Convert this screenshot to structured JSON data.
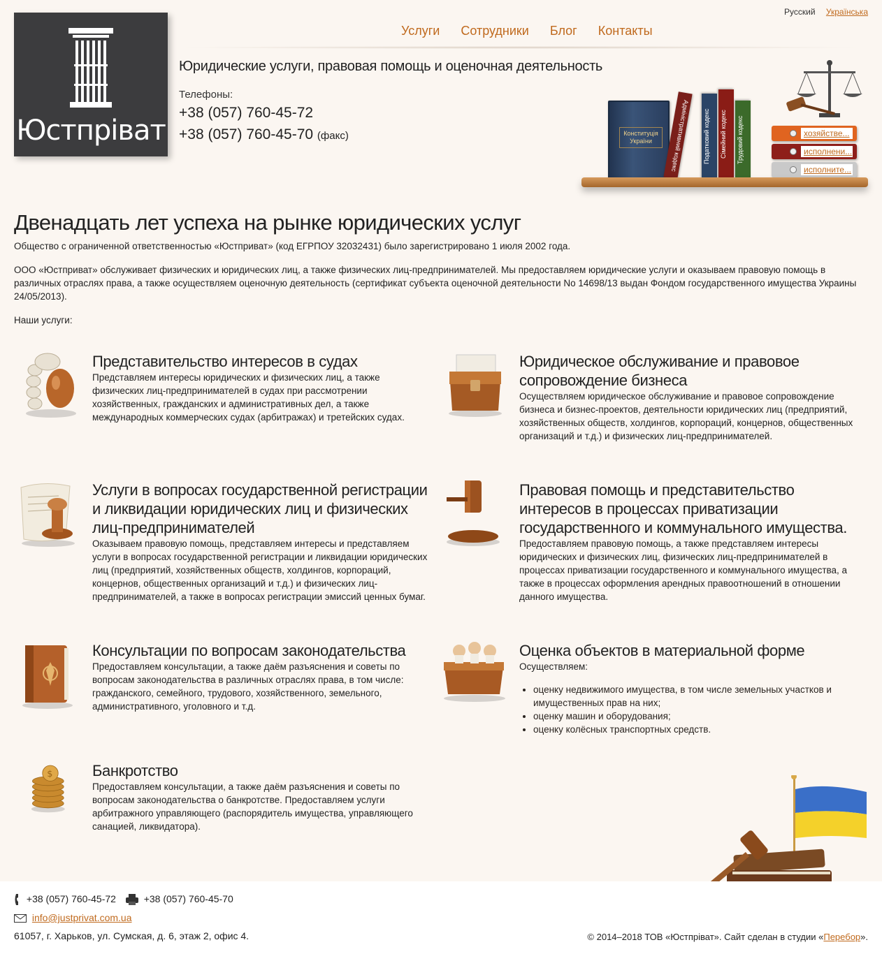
{
  "brand": {
    "name": "Юстпріват"
  },
  "lang": {
    "current": "Русский",
    "other": "Українська"
  },
  "nav": [
    "Услуги",
    "Сотрудники",
    "Блог",
    "Контакты"
  ],
  "header": {
    "tagline": "Юридические услуги, правовая помощь и оценочная деятельность",
    "phones_label": "Телефоны:",
    "phone1": "+38 (057) 760-45-72",
    "phone2": "+38 (057) 760-45-70",
    "fax_label": "(факс)"
  },
  "shelf": {
    "constitution": "Конституція України",
    "spines": [
      "Адміністративний кодекс",
      "Податковий кодекс",
      "Сімейний кодекс",
      "Трудовий кодекс"
    ],
    "folders": [
      "хозяйстве...",
      "исполнени...",
      "исполните..."
    ]
  },
  "main": {
    "title": "Двенадцать лет успеха на рынке юридических услуг",
    "p1": "Общество с ограниченной ответственностью «Юстприват» (код ЕГРПОУ 32032431) было зарегистрировано 1 июля 2002 года.",
    "p2": "ООО «Юстприват» обслуживает физических и юридических лиц, а также физических лиц-предпринимателей. Мы предоставляем юридические услуги и оказываем правовую помощь в различных отраслях права, а также осуществляем оценочную деятельность (сертификат субъекта оценочной деятельности No 14698/13 выдан Фондом государственного имущества Украины 24/05/2013).",
    "p3": "Наши услуги:"
  },
  "services": [
    {
      "title": "Представительство интересов в судах",
      "text": "Представляем интересы юридических и физических лиц, а также физических лиц-предпринимателей в судах при рассмотрении хозяйственных, гражданских и административных дел, а также международных коммерческих судах (арбитражах) и третейских судах."
    },
    {
      "title": "Юридическое обслуживание и правовое сопровождение бизнеса",
      "text": "Осуществляем юридическое обслуживание и правовое сопровождение бизнеса и бизнес-проектов, деятельности юридических лиц (предприятий, хозяйственных обществ, холдингов, корпораций, концернов, общественных организаций и т.д.) и физических лиц-предпринимателей."
    },
    {
      "title": "Услуги в вопросах государственной регистрации и ликвидации юридических лиц и физических лиц-предпринимателей",
      "text": "Оказываем правовую помощь, представляем интересы и представляем услуги в вопросах государственной регистрации и ликвидации юридических лиц (предприятий, хозяйственных обществ, холдингов, корпораций, концернов, общественных организаций и т.д.) и физических лиц-предпринимателей, а также в вопросах регистрации эмиссий ценных бумаг."
    },
    {
      "title": "Правовая помощь и представительство интересов в процессах приватизации государственного и коммунального имущества.",
      "text": "Предоставляем правовую помощь, а также представляем интересы юридических и физических лиц, физических лиц-предпринимателей в процессах приватизации государственного и коммунального имущества, а также в процессах оформления арендных правоотношений в отношении данного имущества."
    },
    {
      "title": "Консультации по вопросам законодательства",
      "text": "Предоставляем консультации, а также даём разъяснения и советы по вопросам законодательства в различных отраслях права, в том числе: гражданского, семейного, трудового, хозяйственного, земельного, административного, уголовного и т.д."
    },
    {
      "title": "Оценка объектов в материальной форме",
      "text": "Осуществляем:",
      "items": [
        "оценку недвижимого имущества, в том числе земельных участков и имущественных прав на них;",
        "оценку машин и оборудования;",
        "оценку колёсных транспортных средств."
      ]
    },
    {
      "title": "Банкротство",
      "text": "Предоставляем консультации, а также даём разъяснения и советы по вопросам законодательства о банкротстве. Предоставляем услуги арбитражного управляющего (распорядитель имущества, управляющего санацией, ликвидатора)."
    }
  ],
  "footer": {
    "phone": "+38 (057) 760-45-72",
    "fax": "+38 (057) 760-45-70",
    "email": "info@justprivat.com.ua",
    "address": "61057, г. Харьков, ул. Сумская, д. 6, этаж 2, офис 4.",
    "copyright_pre": "© 2014–2018 ТОВ «Юстпріват». Сайт сделан в студии «",
    "studio": "Перебор",
    "copyright_post": "»."
  },
  "colors": {
    "accent": "#c06a1e",
    "background": "#fbf6f1",
    "logo_bg": "#3c3c3e"
  }
}
